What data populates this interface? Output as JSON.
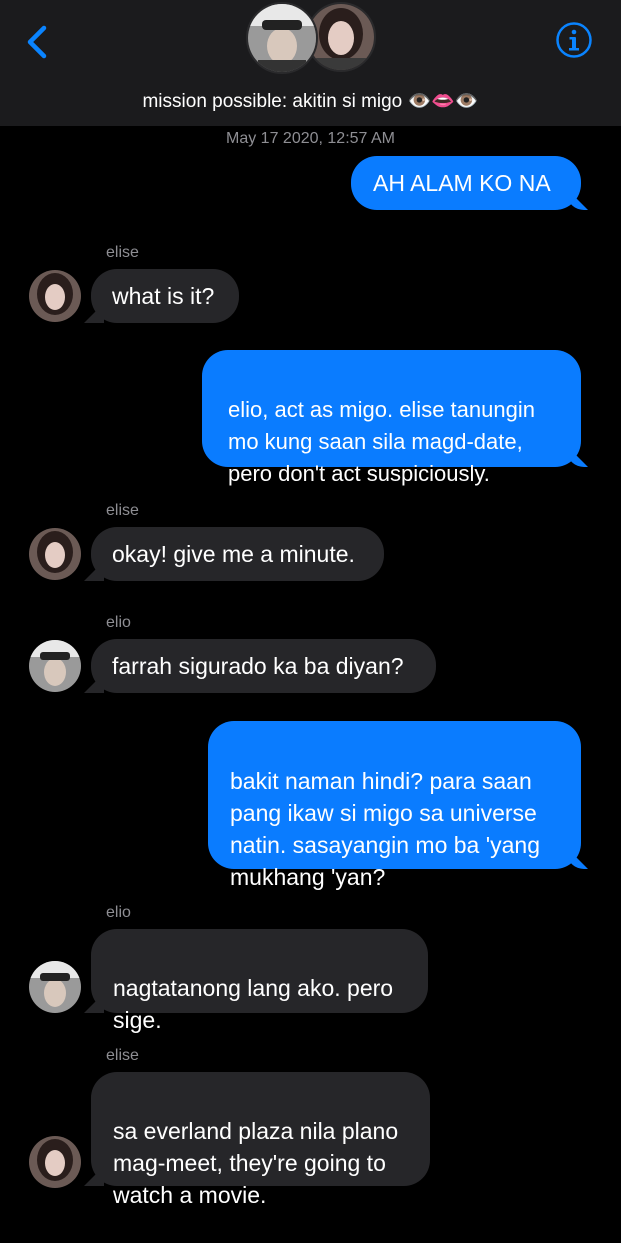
{
  "header": {
    "group_title": "mission possible: akitin si migo 👁️👄👁️",
    "back_icon": "chevron-left-icon",
    "info_icon": "info-circle-icon"
  },
  "timestamp": "May 17 2020, 12:57 AM",
  "colors": {
    "accent": "#0a7cff",
    "incoming_bubble": "#262629",
    "header_bg": "#1b1b1d",
    "meta_text": "#8e8e93"
  },
  "messages": [
    {
      "direction": "outgoing",
      "text": "AH ALAM KO NA"
    },
    {
      "direction": "incoming",
      "sender": "elise",
      "text": "what is it?"
    },
    {
      "direction": "outgoing",
      "text": "elio, act as migo. elise tanungin\nmo kung saan sila magd-date,\npero don't act suspiciously."
    },
    {
      "direction": "incoming",
      "sender": "elise",
      "text": "okay! give me a minute."
    },
    {
      "direction": "incoming",
      "sender": "elio",
      "text": "farrah sigurado ka ba diyan?"
    },
    {
      "direction": "outgoing",
      "text": "bakit naman hindi? para saan\npang ikaw si migo sa universe\nnatin. sasayangin mo ba 'yang\nmukhang 'yan?"
    },
    {
      "direction": "incoming",
      "sender": "elio",
      "text": "nagtatanong lang ako. pero\nsige."
    },
    {
      "direction": "incoming",
      "sender": "elise",
      "text": "sa everland plaza nila plano\nmag-meet, they're going to\nwatch a movie."
    }
  ]
}
